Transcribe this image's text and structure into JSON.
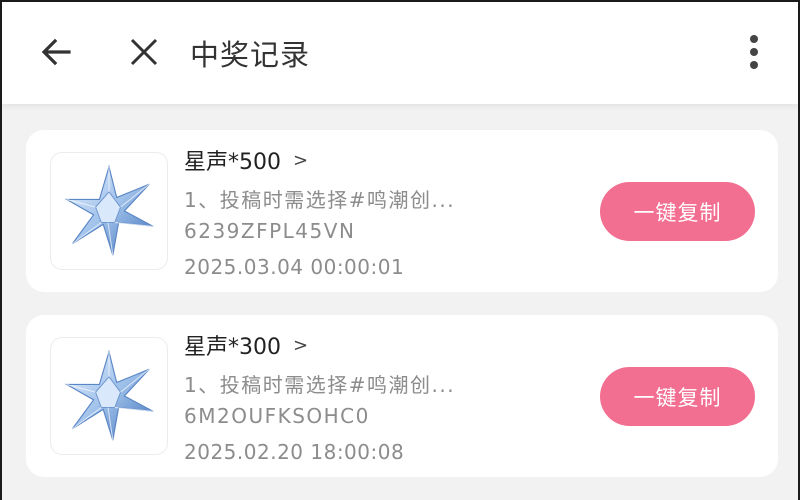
{
  "header": {
    "title": "中奖记录",
    "back_icon": "arrow-left-icon",
    "close_icon": "close-icon",
    "more_icon": "more-vertical-icon"
  },
  "records": [
    {
      "prize_name": "星声*500",
      "chevron": ">",
      "description": "1、投稿时需选择#鸣潮创...",
      "code": "6239ZFPL45VN",
      "time": "2025.03.04 00:00:01",
      "copy_label": "一键复制",
      "icon": "star-crystal-icon"
    },
    {
      "prize_name": "星声*300",
      "chevron": ">",
      "description": "1、投稿时需选择#鸣潮创...",
      "code": "6M2OUFKSOHC0",
      "time": "2025.02.20 18:00:08",
      "copy_label": "一键复制",
      "icon": "star-crystal-icon"
    }
  ],
  "colors": {
    "accent": "#f26f91",
    "background": "#f2f2f2",
    "card": "#ffffff"
  }
}
